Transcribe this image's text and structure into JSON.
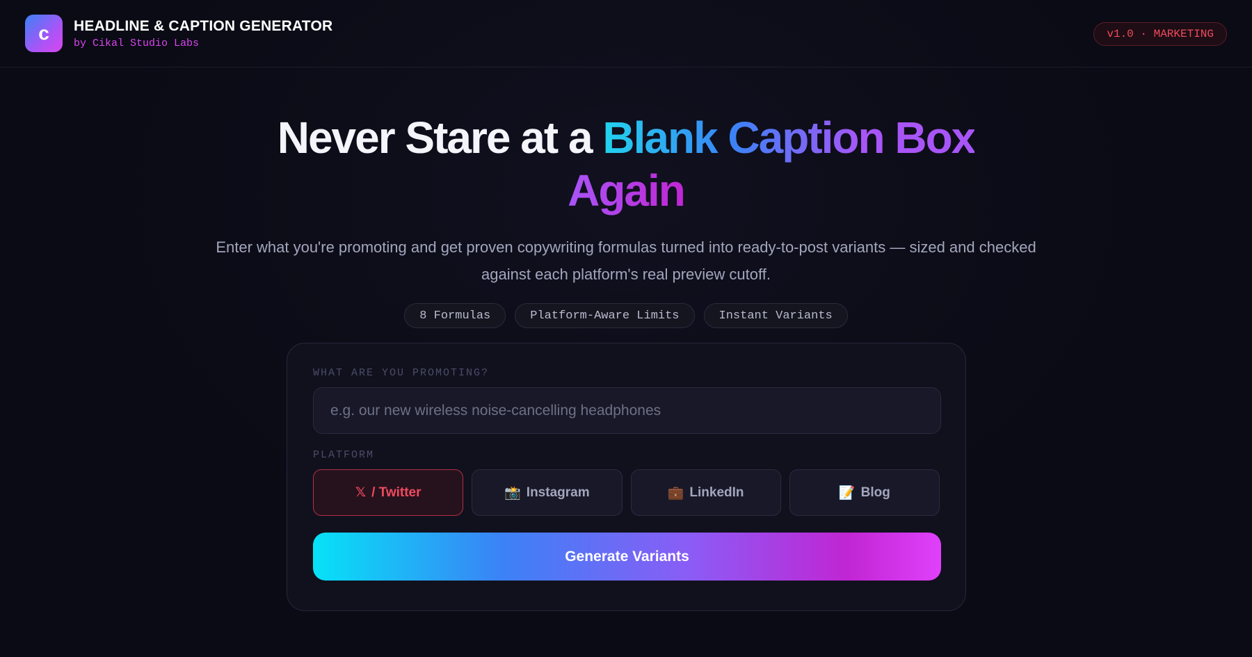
{
  "header": {
    "logo_letter": "c",
    "title": "HEADLINE & CAPTION GENERATOR",
    "subtitle": "by Cikal Studio Labs",
    "version_badge": "v1.0 · MARKETING"
  },
  "hero": {
    "title_plain": "Never Stare at a ",
    "title_gradient": "Blank Caption Box",
    "title_gradient2": "Again",
    "description": "Enter what you're promoting and get proven copywriting formulas turned into ready-to-post variants — sized and checked against each platform's real preview cutoff.",
    "pills": [
      "8 Formulas",
      "Platform-Aware Limits",
      "Instant Variants"
    ]
  },
  "form": {
    "promo_label": "WHAT ARE YOU PROMOTING?",
    "promo_placeholder": "e.g. our new wireless noise-cancelling headphones",
    "promo_value": "",
    "platform_label": "PLATFORM",
    "platforms": [
      {
        "icon": "x-logo-icon",
        "glyph": "𝕏",
        "label": "/ Twitter",
        "selected": true
      },
      {
        "icon": "camera-icon",
        "glyph": "📸",
        "label": "Instagram",
        "selected": false
      },
      {
        "icon": "briefcase-icon",
        "glyph": "💼",
        "label": "LinkedIn",
        "selected": false
      },
      {
        "icon": "memo-icon",
        "glyph": "📝",
        "label": "Blog",
        "selected": false
      }
    ],
    "generate_label": "Generate Variants"
  },
  "colors": {
    "background": "#0b0b15",
    "accent_pink": "#d946ef",
    "accent_red": "#f04a5f",
    "gradient_start": "#06e2f7",
    "gradient_end": "#e040fb"
  }
}
